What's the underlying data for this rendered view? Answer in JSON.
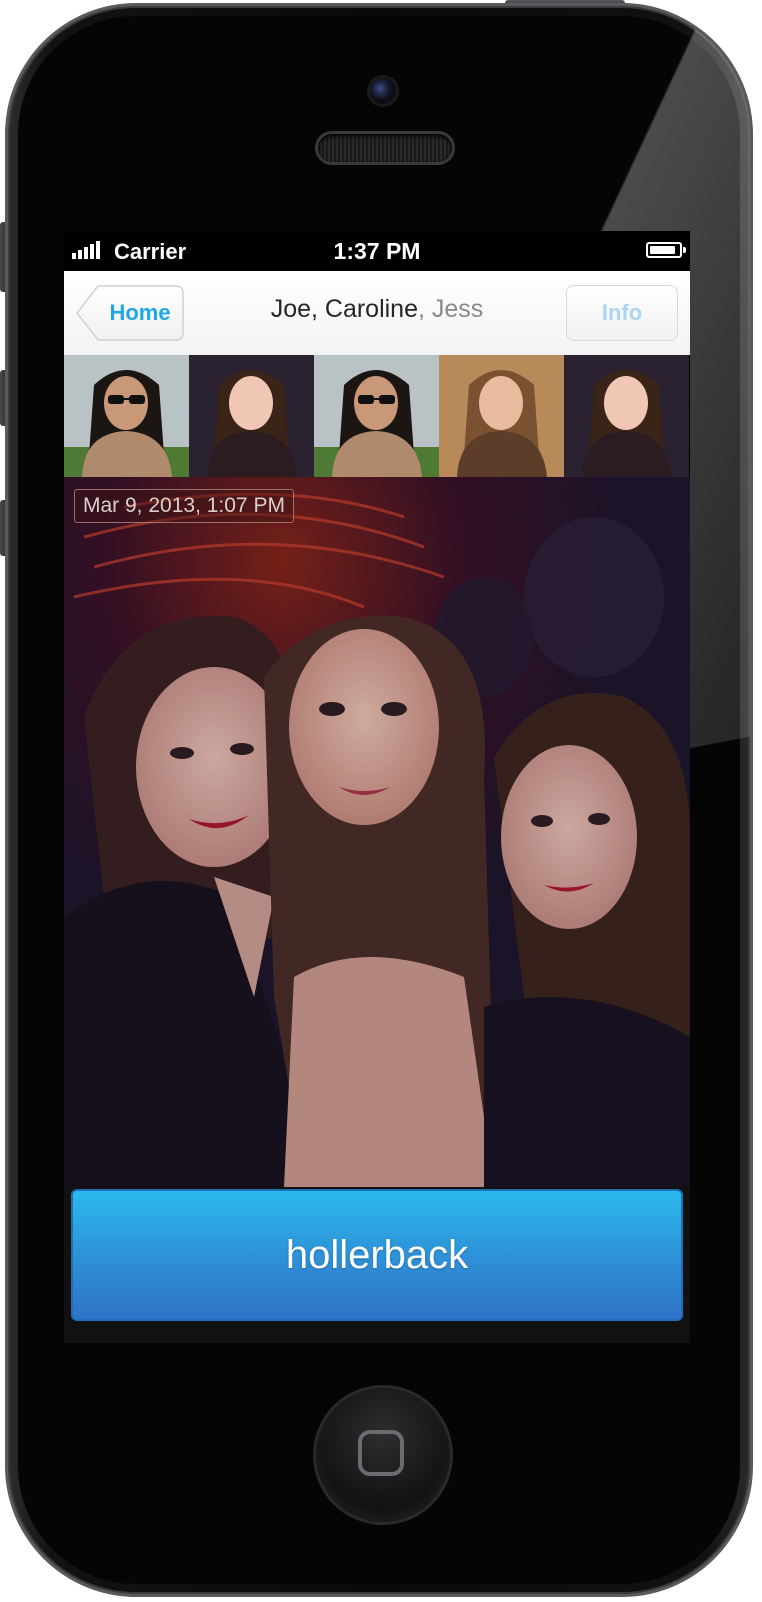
{
  "status_bar": {
    "carrier": "Carrier",
    "time": "1:37 PM",
    "battery_level": 0.9
  },
  "nav": {
    "back_label": "Home",
    "title_primary": "Joe, Caroline",
    "title_secondary": ", Jess",
    "info_label": "Info"
  },
  "thumbnails": [
    {
      "person": "man-sunglasses",
      "selected": false
    },
    {
      "person": "woman-dark-hair",
      "selected": true
    },
    {
      "person": "man-sunglasses",
      "selected": false
    },
    {
      "person": "woman-light-brown-hair",
      "selected": false
    },
    {
      "person": "woman-dark-hair",
      "selected": false
    }
  ],
  "photo": {
    "timestamp": "Mar 9, 2013, 1:07 PM"
  },
  "action": {
    "label": "hollerback"
  },
  "colors": {
    "accent": "#1ea7e4",
    "button_top": "#2bb8ec",
    "button_bottom": "#2f73c8",
    "info_disabled": "#a8d6f1"
  },
  "icons": {
    "back": "chevron-left-back-button",
    "home_button": "rounded-square-icon"
  }
}
